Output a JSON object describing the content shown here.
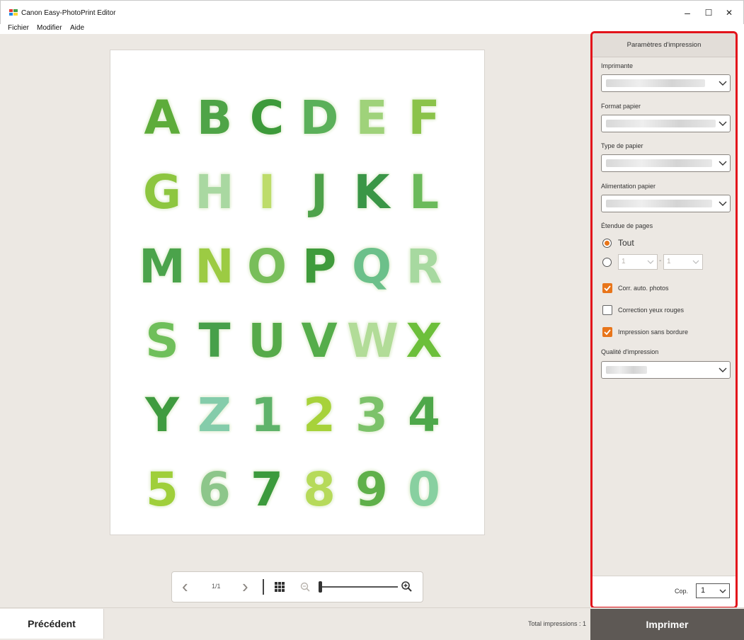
{
  "window": {
    "title": "Canon Easy-PhotoPrint Editor",
    "minimize": "–",
    "maximize": "☐",
    "close": "✕"
  },
  "menu": [
    "Fichier",
    "Modifier",
    "Aide"
  ],
  "letters": [
    {
      "ch": "A",
      "color": "#5dac3a"
    },
    {
      "ch": "B",
      "color": "#4fa447"
    },
    {
      "ch": "C",
      "color": "#3d9a3a"
    },
    {
      "ch": "D",
      "color": "#5bb05a"
    },
    {
      "ch": "E",
      "color": "#9fd27a"
    },
    {
      "ch": "F",
      "color": "#8bc34a"
    },
    {
      "ch": "G",
      "color": "#8dc63f"
    },
    {
      "ch": "H",
      "color": "#a9d8a1"
    },
    {
      "ch": "I",
      "color": "#bddc6a"
    },
    {
      "ch": "J",
      "color": "#4ea24a"
    },
    {
      "ch": "K",
      "color": "#3a9646"
    },
    {
      "ch": "L",
      "color": "#6bba5a"
    },
    {
      "ch": "M",
      "color": "#4ba34b"
    },
    {
      "ch": "N",
      "color": "#9ccb43"
    },
    {
      "ch": "O",
      "color": "#78be5a"
    },
    {
      "ch": "P",
      "color": "#3f9b3b"
    },
    {
      "ch": "Q",
      "color": "#6cc08a"
    },
    {
      "ch": "R",
      "color": "#a7d9a0"
    },
    {
      "ch": "S",
      "color": "#6fbf5a"
    },
    {
      "ch": "T",
      "color": "#47a04a"
    },
    {
      "ch": "U",
      "color": "#56aa49"
    },
    {
      "ch": "V",
      "color": "#55ad4a"
    },
    {
      "ch": "W",
      "color": "#b2dc98"
    },
    {
      "ch": "X",
      "color": "#6cbf3a"
    },
    {
      "ch": "Y",
      "color": "#3f9b3f"
    },
    {
      "ch": "Z",
      "color": "#84ccaa"
    },
    {
      "ch": "1",
      "color": "#5fb36a"
    },
    {
      "ch": "2",
      "color": "#a7d23a"
    },
    {
      "ch": "3",
      "color": "#7cc26a"
    },
    {
      "ch": "4",
      "color": "#4ea84a"
    },
    {
      "ch": "5",
      "color": "#9fcf3a"
    },
    {
      "ch": "6",
      "color": "#8dc68a"
    },
    {
      "ch": "7",
      "color": "#3c9a3c"
    },
    {
      "ch": "8",
      "color": "#b6da5a"
    },
    {
      "ch": "9",
      "color": "#5fb04a"
    },
    {
      "ch": "0",
      "color": "#88d0a0"
    }
  ],
  "pager": {
    "prev": "‹",
    "page": "1/1",
    "next": "›"
  },
  "zoom": {
    "level": 0.0
  },
  "panel": {
    "header": "Paramètres d'impression",
    "printer_label": "Imprimante",
    "paper_size_label": "Format papier",
    "paper_type_label": "Type de papier",
    "paper_source_label": "Alimentation papier",
    "page_range_label": "Étendue de pages",
    "range_all": "Tout",
    "range_from": "1",
    "range_sep": "-",
    "range_to": "1",
    "auto_photo_fix": "Corr. auto. photos",
    "red_eye": "Correction yeux rouges",
    "borderless": "Impression sans bordure",
    "quality_label": "Qualité d'impression",
    "copies_label": "Cop.",
    "copies_value": "1"
  },
  "bottom": {
    "previous": "Précédent",
    "total": "Total impressions : 1",
    "print": "Imprimer"
  },
  "colors": {
    "accent": "#e8751a",
    "highlight_border": "#e3131b",
    "print_button": "#5e5955"
  }
}
